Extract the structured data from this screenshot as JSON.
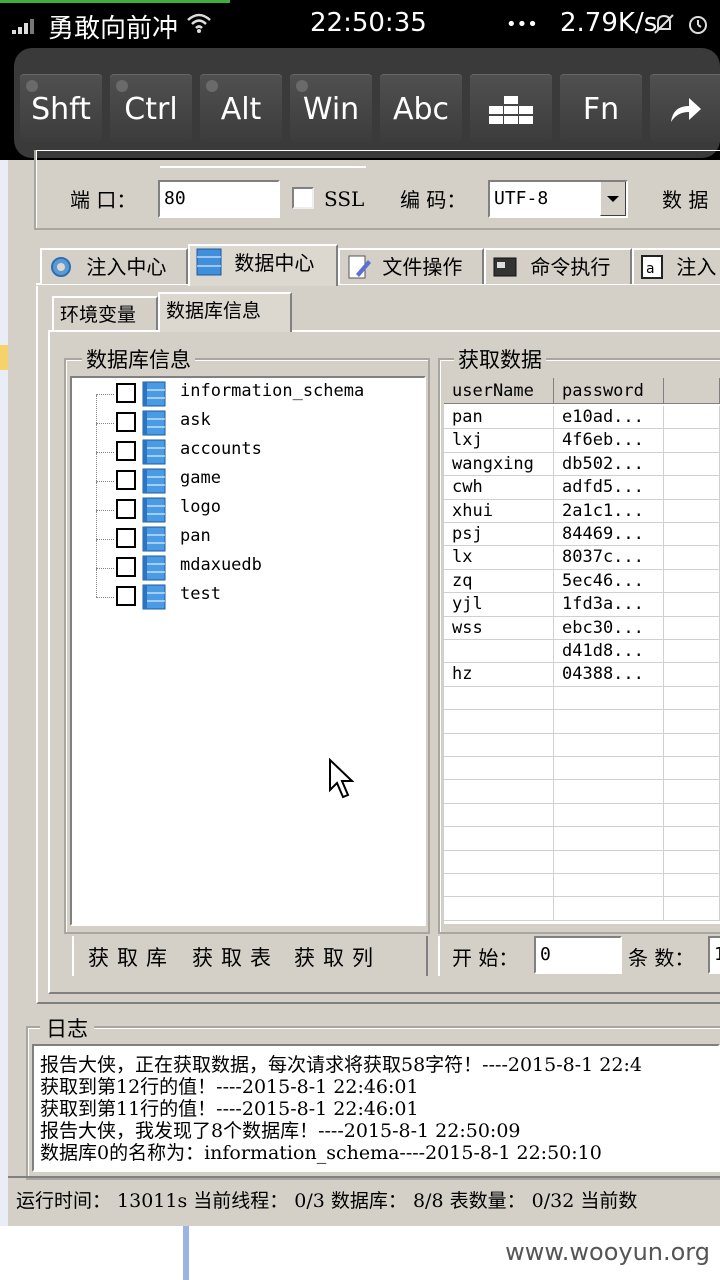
{
  "status_bar": {
    "carrier": "勇敢向前冲",
    "time": "22:50:35",
    "dots": "•••",
    "net_speed": "2.79K/s",
    "icons": [
      "signal-icon",
      "wifi-icon",
      "mute-icon",
      "alarm-icon"
    ]
  },
  "keyboard": {
    "keys": [
      "Shft",
      "Ctrl",
      "Alt",
      "Win",
      "Abc",
      "",
      "Fn",
      ""
    ],
    "icons": [
      "keypad-icon",
      "arrow-forward-icon"
    ]
  },
  "settings": {
    "port_label": "端 口：",
    "port_value": "80",
    "ssl_label": "SSL",
    "encoding_label": "编 码：",
    "encoding_value": "UTF-8",
    "extra_label": "数 据"
  },
  "main_tabs": [
    "注入中心",
    "数据中心",
    "文件操作",
    "命令执行",
    "注入"
  ],
  "sub_tabs": [
    "环境变量",
    "数据库信息"
  ],
  "db_panel": {
    "title": "数据库信息",
    "databases": [
      "information_schema",
      "ask",
      "accounts",
      "game",
      "logo",
      "pan",
      "mdaxuedb",
      "test"
    ],
    "buttons": [
      "获取库",
      "获取表",
      "获取列"
    ]
  },
  "data_panel": {
    "title": "获取数据",
    "columns": [
      "userName",
      "password"
    ],
    "rows": [
      [
        "pan",
        "e10ad..."
      ],
      [
        "lxj",
        "4f6eb..."
      ],
      [
        "wangxing",
        "db502..."
      ],
      [
        "cwh",
        "adfd5..."
      ],
      [
        "xhui",
        "2a1c1..."
      ],
      [
        "psj",
        "84469..."
      ],
      [
        "lx",
        "8037c..."
      ],
      [
        "zq",
        "5ec46..."
      ],
      [
        "yjl",
        "1fd3a..."
      ],
      [
        "wss",
        "ebc30..."
      ],
      [
        "",
        "d41d8..."
      ],
      [
        "hz",
        "04388..."
      ]
    ],
    "start_label": "开 始：",
    "start_value": "0",
    "count_label": "条 数：",
    "count_value": "1"
  },
  "log": {
    "title": "日志",
    "lines": [
      "报告大侠，正在获取数据，每次请求将获取58字符！----2015-8-1 22:4",
      "获取到第12行的值！----2015-8-1 22:46:01",
      "获取到第11行的值！----2015-8-1 22:46:01",
      "报告大侠，我发现了8个数据库！----2015-8-1 22:50:09",
      "数据库0的名称为：information_schema----2015-8-1 22:50:10"
    ]
  },
  "status_line": "运行时间： 13011s 当前线程： 0/3 数据库： 8/8 表数量： 0/32 当前数",
  "watermark": "www.wooyun.org"
}
